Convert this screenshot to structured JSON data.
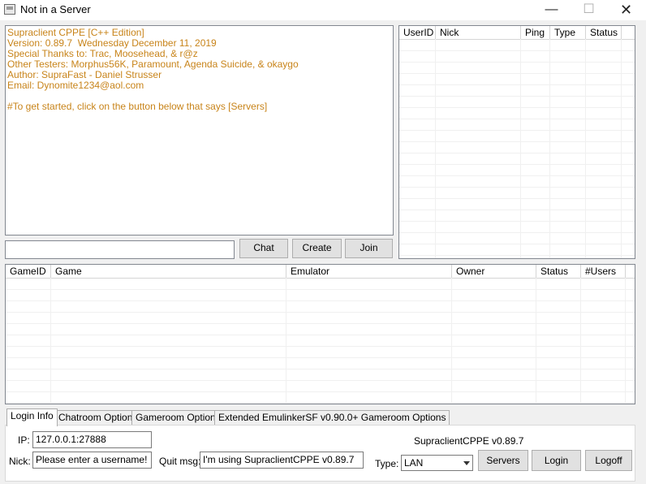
{
  "window": {
    "title": "Not in a Server",
    "minimize_glyph": "—",
    "maximize_glyph": "☐",
    "close_glyph": "✕"
  },
  "info_lines": [
    "Supraclient CPPE [C++ Edition]",
    "Version: 0.89.7  Wednesday December 11, 2019",
    "Special Thanks to: Trac, Moosehead, & r@z",
    "Other Testers: Morphus56K, Paramount, Agenda Suicide, & okaygo",
    "Author: SupraFast - Daniel Strusser",
    "Email: Dynomite1234@aol.com",
    "",
    "#To get started, click on the button below that says [Servers]"
  ],
  "info_text_color": "#c8841a",
  "chat": {
    "input_value": "",
    "chat_label": "Chat",
    "create_label": "Create",
    "join_label": "Join"
  },
  "users_list": {
    "columns": [
      "UserID",
      "Nick",
      "Ping",
      "Type",
      "Status"
    ],
    "rows": []
  },
  "games_list": {
    "columns": [
      "GameID",
      "Game",
      "Emulator",
      "Owner",
      "Status",
      "#Users"
    ],
    "rows": []
  },
  "tabs": [
    "Login Info",
    "Chatroom Options",
    "Gameroom Options",
    "Extended EmulinkerSF v0.90.0+ Gameroom Options"
  ],
  "login": {
    "ip_label": "IP:",
    "ip_value": "127.0.0.1:27888",
    "nick_label": "Nick:",
    "nick_value": "Please enter a username!",
    "quit_label": "Quit msg:",
    "quit_value": "I'm using SupraclientCPPE v0.89.7",
    "version_text": "SupraclientCPPE v0.89.7",
    "type_label": "Type:",
    "type_value": "LAN",
    "servers_label": "Servers",
    "login_label": "Login",
    "logoff_label": "Logoff"
  }
}
